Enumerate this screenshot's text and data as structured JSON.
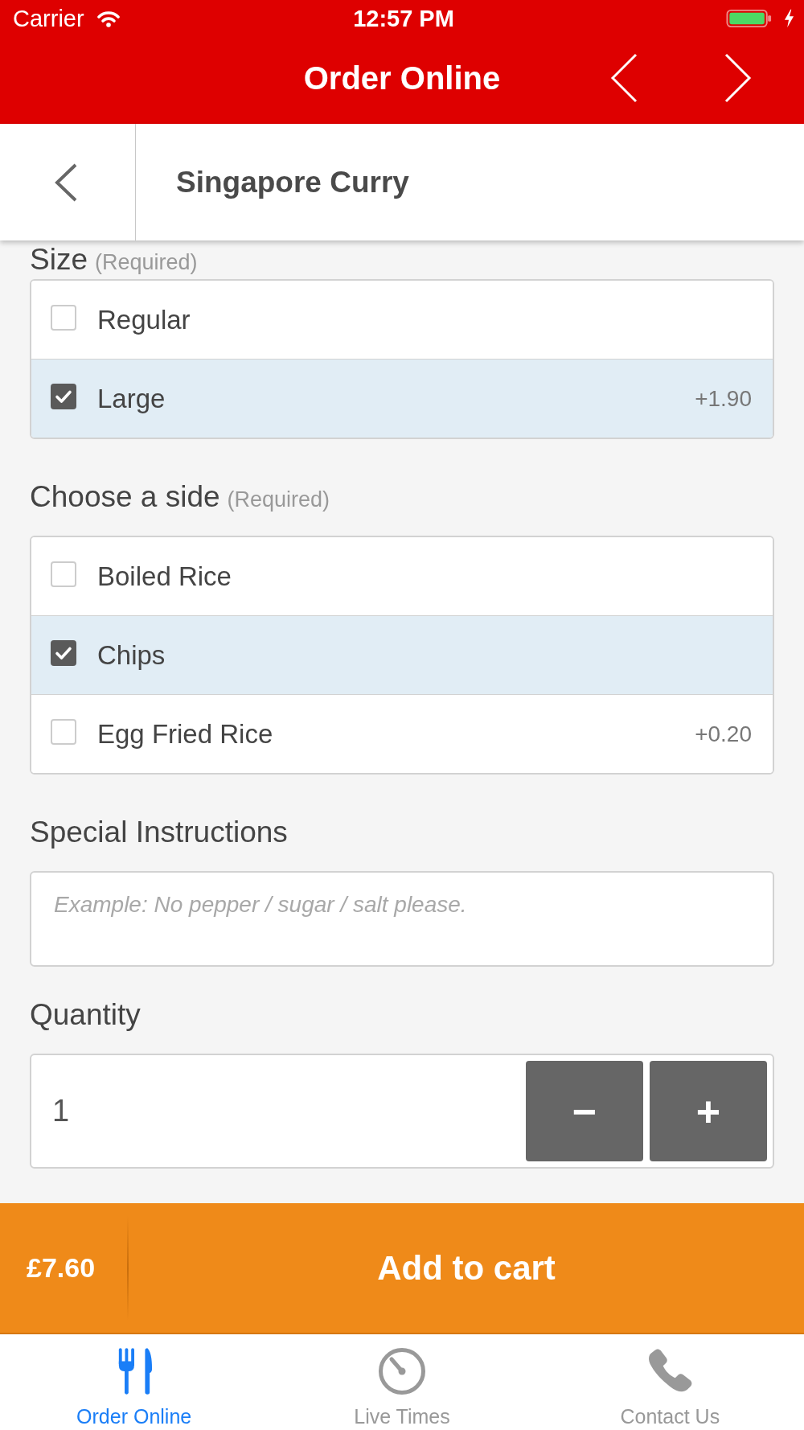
{
  "status_bar": {
    "carrier": "Carrier",
    "time": "12:57 PM",
    "charging": true
  },
  "nav_bar": {
    "title": "Order Online"
  },
  "item_header": {
    "title": "Singapore Curry"
  },
  "option_groups": [
    {
      "title": "Size",
      "note": "(Required)",
      "options": [
        {
          "label": "Regular",
          "checked": false
        },
        {
          "label": "Large",
          "price": "+1.90",
          "checked": true
        }
      ]
    },
    {
      "title": "Choose a side",
      "note": "(Required)",
      "options": [
        {
          "label": "Boiled Rice",
          "checked": false
        },
        {
          "label": "Chips",
          "checked": true
        },
        {
          "label": "Egg Fried Rice",
          "price": "+0.20",
          "checked": false
        }
      ]
    }
  ],
  "special_instructions": {
    "label": "Special Instructions",
    "placeholder": "Example: No pepper / sugar / salt please."
  },
  "quantity": {
    "label": "Quantity",
    "value": "1",
    "decrease": "−",
    "increase": "+"
  },
  "cart_bar": {
    "total": "£7.60",
    "action": "Add to cart"
  },
  "tab_bar": [
    {
      "label": "Order Online",
      "selected": true
    },
    {
      "label": "Live Times",
      "selected": false
    },
    {
      "label": "Contact Us",
      "selected": false
    }
  ]
}
